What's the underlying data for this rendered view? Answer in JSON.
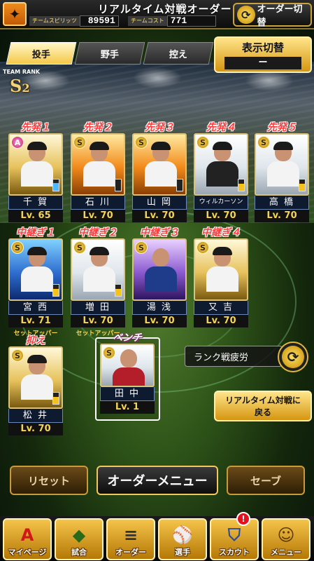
{
  "header": {
    "title": "リアルタイム対戦オーダー",
    "team_spirit_label": "チームスピリッツ",
    "team_spirit_value": "89591",
    "team_cost_label": "チームコスト",
    "team_cost_value": "771",
    "order_swap_label": "オーダー切替"
  },
  "tabs": [
    {
      "label": "投手",
      "active": true
    },
    {
      "label": "野手",
      "active": false
    },
    {
      "label": "控え",
      "active": false
    }
  ],
  "display_toggle": {
    "label": "表示切替",
    "value": "ー"
  },
  "team_rank": {
    "label": "TEAM RANK",
    "letter": "S",
    "number": "2"
  },
  "starters": [
    {
      "role": "先発１",
      "name": "千 賀",
      "level": "Lv. 65"
    },
    {
      "role": "先発２",
      "name": "石 川",
      "level": "Lv. 70"
    },
    {
      "role": "先発３",
      "name": "山 岡",
      "level": "Lv. 70"
    },
    {
      "role": "先発４",
      "name": "ウィルカーソン",
      "level": "Lv. 70"
    },
    {
      "role": "先発５",
      "name": "高 橋",
      "level": "Lv. 70"
    }
  ],
  "relievers": [
    {
      "role": "中継ぎ１",
      "name": "宮 西",
      "level": "Lv. 71",
      "sub": "セットアッパー"
    },
    {
      "role": "中継ぎ２",
      "name": "増 田",
      "level": "Lv. 70",
      "sub": "セットアッパー"
    },
    {
      "role": "中継ぎ３",
      "name": "湯 浅",
      "level": "Lv. 70",
      "sub": ""
    },
    {
      "role": "中継ぎ４",
      "name": "又 吉",
      "level": "Lv. 70",
      "sub": ""
    }
  ],
  "closer": {
    "role": "抑え",
    "name": "松 井",
    "level": "Lv. 70"
  },
  "bench": {
    "role": "ベンチ",
    "name": "田 中",
    "level": "Lv.  1"
  },
  "rank_fatigue_label": "ランク戦疲労",
  "return_button": {
    "line1": "リアルタイム対戦に",
    "line2": "戻る"
  },
  "actions": {
    "reset": "リセット",
    "order_menu": "オーダーメニュー",
    "save": "セーブ"
  },
  "nav": {
    "mypage": "マイページ",
    "match": "試合",
    "order": "オーダー",
    "players": "選手",
    "scout": "スカウト",
    "menu": "メニュー",
    "scout_badge": "!"
  }
}
